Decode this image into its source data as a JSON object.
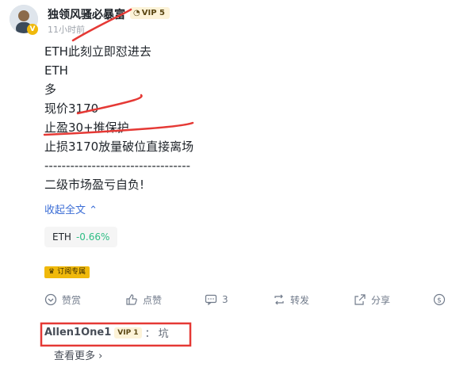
{
  "post": {
    "author": "独领风骚必暴富",
    "vip": "VIP 5",
    "avatar_badge": "V",
    "time": "11小时前",
    "lines": [
      "ETH此刻立即怼进去",
      "ETH",
      "多",
      "现价3170",
      "止盈30+推保护",
      "止损3170放量破位直接离场",
      "----------------------------------",
      "二级市场盈亏自负!"
    ],
    "expand": "收起全文 ⌃",
    "coin_tag": {
      "symbol": "ETH",
      "change": "-0.66%"
    },
    "subscribe_badge": "订阅专属"
  },
  "actions": {
    "tip": "赞赏",
    "like": "点赞",
    "comment_count": "3",
    "repost": "转发",
    "share": "分享",
    "dollar_icon": "dollar-icon"
  },
  "comment": {
    "user": "Allen1One1",
    "vip": "VIP 1",
    "sep": "：",
    "text": "坑",
    "see_more": "查看更多 ›"
  },
  "colors": {
    "accent_link": "#3c6ed6",
    "change_color": "#2ebd85",
    "vip_bg": "#fdf3d8",
    "annotation_red": "#e53935"
  }
}
